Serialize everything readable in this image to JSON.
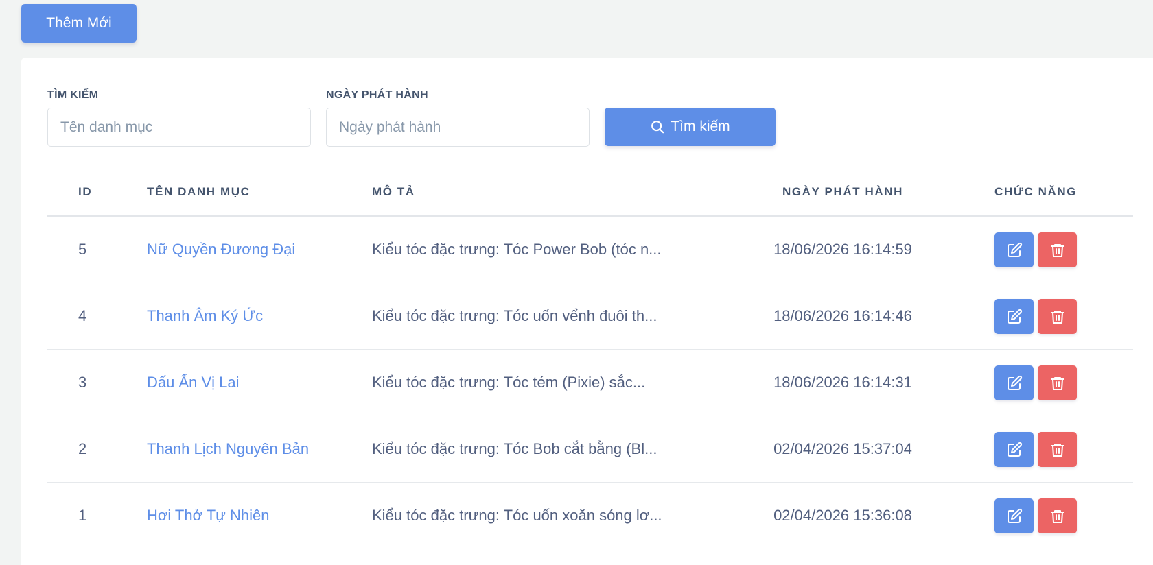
{
  "toolbar": {
    "add_label": "Thêm Mới"
  },
  "filters": {
    "search_label": "TÌM KIẾM",
    "search_placeholder": "Tên danh mục",
    "search_value": "",
    "date_label": "NGÀY PHÁT HÀNH",
    "date_placeholder": "Ngày phát hành",
    "date_value": "",
    "search_button": "Tìm kiếm"
  },
  "table": {
    "headers": {
      "id": "ID",
      "name": "TÊN DANH MỤC",
      "desc": "MÔ TẢ",
      "date": "NGÀY PHÁT HÀNH",
      "actions": "CHỨC NĂNG"
    },
    "rows": [
      {
        "id": "5",
        "name": "Nữ Quyền Đương Đại",
        "desc": "Kiểu tóc đặc trưng: Tóc Power Bob (tóc n...",
        "date": "18/06/2026 16:14:59"
      },
      {
        "id": "4",
        "name": "Thanh Âm Ký Ức",
        "desc": "Kiểu tóc đặc trưng: Tóc uốn vểnh đuôi th...",
        "date": "18/06/2026 16:14:46"
      },
      {
        "id": "3",
        "name": "Dấu Ấn Vị Lai",
        "desc": "Kiểu tóc đặc trưng: Tóc tém (Pixie) sắc...",
        "date": "18/06/2026 16:14:31"
      },
      {
        "id": "2",
        "name": "Thanh Lịch Nguyên Bản",
        "desc": "Kiểu tóc đặc trưng: Tóc Bob cắt bằng (Bl...",
        "date": "02/04/2026 15:37:04"
      },
      {
        "id": "1",
        "name": "Hơi Thở Tự Nhiên",
        "desc": "Kiểu tóc đặc trưng: Tóc uốn xoăn sóng lơ...",
        "date": "02/04/2026 15:36:08"
      }
    ]
  },
  "icons": {
    "search": "search-icon",
    "edit": "edit-icon",
    "delete": "trash-icon"
  },
  "colors": {
    "primary": "#5e8ee7",
    "danger": "#ec6464",
    "link": "#5e8ee7"
  }
}
